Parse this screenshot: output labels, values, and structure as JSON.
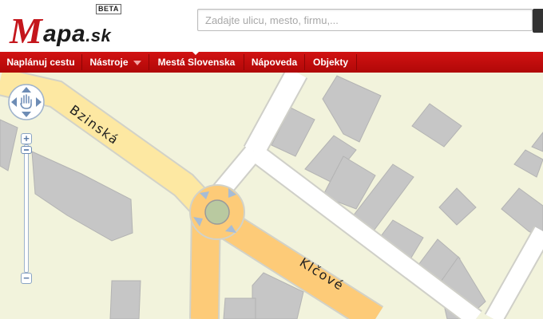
{
  "header": {
    "logo": {
      "mark": "M",
      "rest": "apa",
      "tld": ".sk",
      "badge": "BETA"
    },
    "search": {
      "placeholder": "Zadajte ulicu, mesto, firmu,...",
      "value": ""
    }
  },
  "nav": {
    "items": [
      {
        "label": "Naplánuj cestu"
      },
      {
        "label": "Nástroje",
        "has_dropdown": true
      },
      {
        "label": "Mestá Slovenska",
        "active": true
      },
      {
        "label": "Nápoveda"
      },
      {
        "label": "Objekty"
      }
    ]
  },
  "map": {
    "street_labels": [
      "Bzinská",
      "Klčové"
    ],
    "colors": {
      "land": "#f2f3dc",
      "building": "#c6c6c6",
      "major_road": "#fdd98c",
      "road_casing": "#d0d0c8",
      "minor_road": "#ffffff",
      "nav_red": "#c4161c"
    },
    "controls": {
      "pan_icon": "hand-icon",
      "zoom_in": "+",
      "zoom_out": "−",
      "zoom_level": 0.02
    }
  }
}
